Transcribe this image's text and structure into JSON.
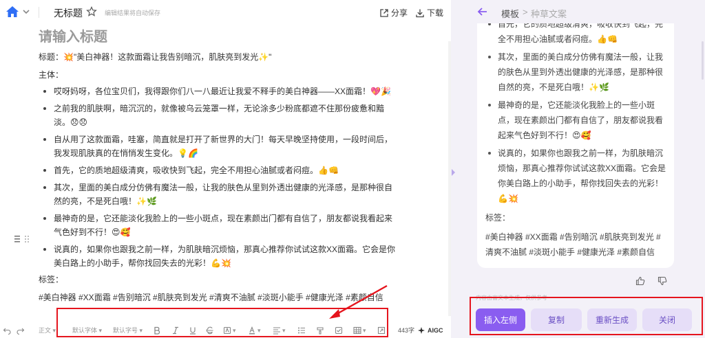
{
  "topbar": {
    "title": "无标题",
    "autosave": "编辑结果将自动保存",
    "share": "分享",
    "download": "下载"
  },
  "editor": {
    "heading_placeholder": "请输入标题",
    "title_line": "标题：💥\"美白神器！这款面霜让我告别暗沉，肌肤亮到发光✨\"",
    "body_label": "主体：",
    "bullets": [
      "哎呀妈呀，各位宝贝们，我得跟你们八一八最近让我爱不释手的美白神器——XX面霜！💖🎉",
      "之前我的肌肤啊，暗沉沉的，就像被乌云笼罩一样，无论涂多少粉底都遮不住那份疲惫和黯淡。😞😞",
      "自从用了这款面霜，哇塞，简直就是打开了新世界的大门！每天早晚坚持使用，一段时间后，我发现肌肤真的在悄悄发生变化。💡🌈",
      "首先，它的质地超级清爽，吸收快到飞起，完全不用担心油腻或者闷痘。👍👊",
      "其次，里面的美白成分仿佛有魔法一般，让我的肤色从里到外透出健康的光泽感，是那种很自然的亮，不是死白哦！✨🌿",
      "最神奇的是，它还能淡化我脸上的一些小斑点，现在素颜出门都有自信了，朋友都说我看起来气色好到不行！😍🥰",
      "说真的，如果你也跟我之前一样，为肌肤暗沉烦恼，那真心推荐你试试这款XX面霜。它会是你美白路上的小助手，帮你找回失去的光彩！💪💥"
    ],
    "tags_label": "标签：",
    "tags": "#美白神器 #XX面霜 #告别暗沉 #肌肤亮到发光 #清爽不油腻 #淡斑小能手 #健康光泽 #素颜自信"
  },
  "toolbar": {
    "paragraph": "正文",
    "font_family": "默认字体",
    "font_size": "默认字号",
    "word_count": "443字",
    "aigc": "AIGC"
  },
  "panel": {
    "breadcrumb_root": "模板",
    "breadcrumb_sep": ">",
    "breadcrumb_current": "种草文案",
    "bullets": [
      "首先，它的质地超级清爽，吸收快到飞起，完全不用担心油腻或者闷痘。👍👊",
      "其次，里面的美白成分仿佛有魔法一般，让我的肤色从里到外透出健康的光泽感，是那种很自然的亮，不是死白哦！✨🌿",
      "最神奇的是，它还能淡化我脸上的一些小斑点，现在素颜出门都有自信了，朋友都说我看起来气色好到不行！😍🥰",
      "说真的，如果你也跟我之前一样，为肌肤暗沉烦恼，那真心推荐你试试这款XX面霜。它会是你美白路上的小助手，帮你找回失去的光彩！💪💥"
    ],
    "tags_label": "标签：",
    "tags": "#美白神器 #XX面霜 #告别暗沉 #肌肤亮到发光 #清爽不油腻 #淡斑小能手 #健康光泽 #素颜自信",
    "ai_note": "内容由富文本生成，仅供参考",
    "buttons": {
      "insert": "插入左侧",
      "copy": "复制",
      "regenerate": "重新生成",
      "close": "关闭"
    }
  },
  "colors": {
    "accent": "#8a5df0",
    "highlight": "#e5141d",
    "home": "#2f6ef5"
  }
}
